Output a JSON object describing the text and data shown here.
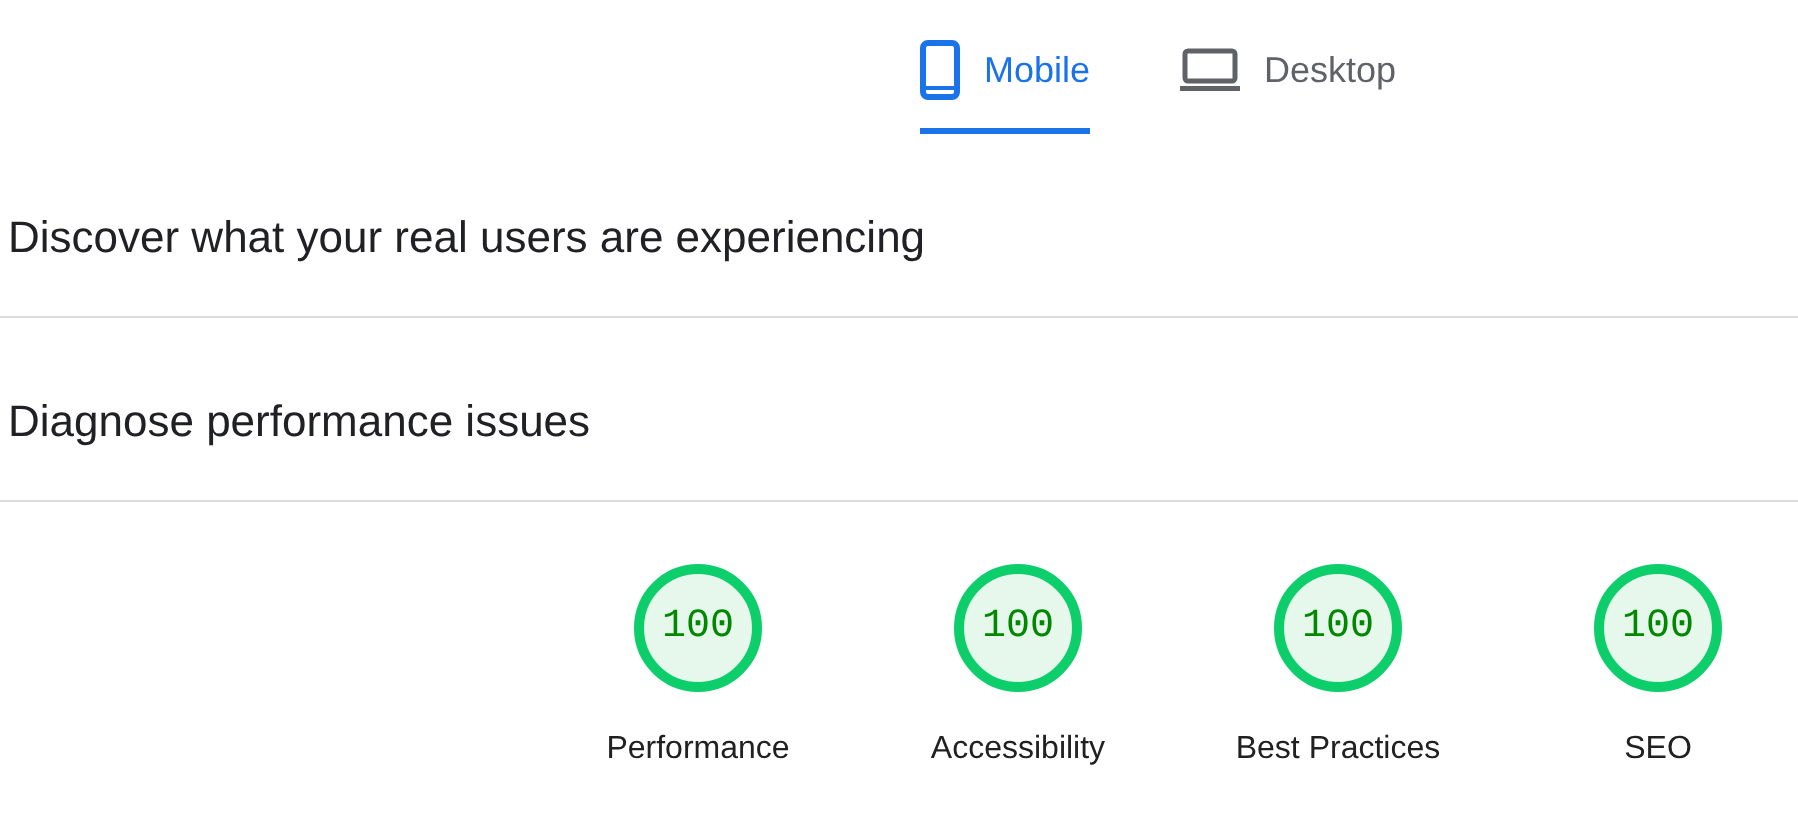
{
  "tabs": [
    {
      "label": "Mobile",
      "kind": "mobile",
      "selected": true
    },
    {
      "label": "Desktop",
      "kind": "desktop",
      "selected": false
    }
  ],
  "sections": [
    {
      "title": "Discover what your real users are experiencing"
    },
    {
      "title": "Diagnose performance issues"
    }
  ],
  "gauges": [
    {
      "score": "100",
      "label": "Performance"
    },
    {
      "score": "100",
      "label": "Accessibility"
    },
    {
      "score": "100",
      "label": "Best Practices"
    },
    {
      "score": "100",
      "label": "SEO"
    }
  ]
}
